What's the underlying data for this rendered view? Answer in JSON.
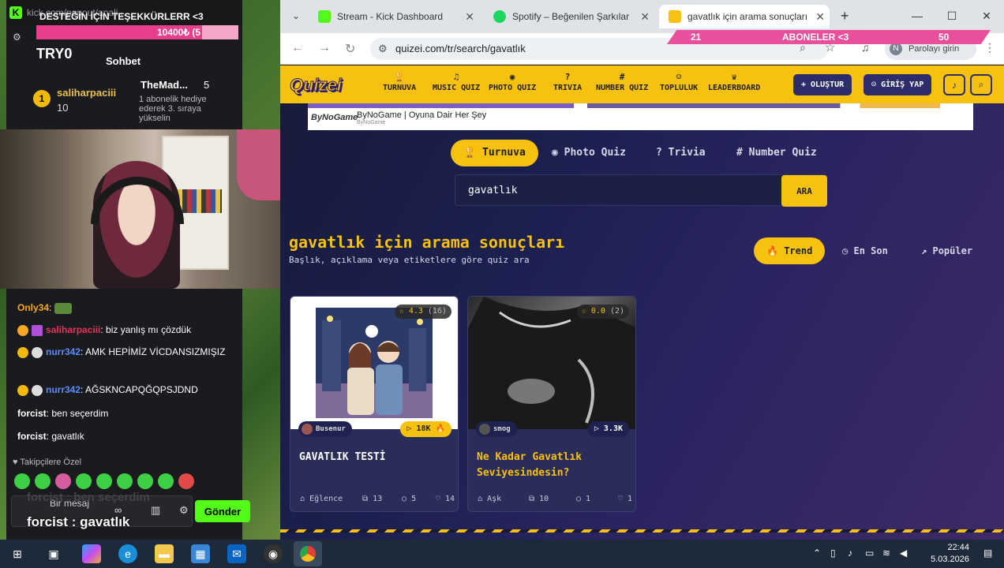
{
  "stream": {
    "url": "kick.com/popout/anali...",
    "goal_label": "10400₺ (5",
    "marquee": "DESTEĞİN İÇİN TEŞEKKÜRLERR <3",
    "streamer_tag": "TRY0",
    "chat_title": "Sohbet",
    "pinned": {
      "badge": "1",
      "user1": "saliharpaciii",
      "count1": "10",
      "user2": "TheMad...",
      "count2": "5",
      "gift_text": "1 abonelik hediye ederek 3. sıraya yükselin"
    },
    "messages": [
      {
        "user": "Only34",
        "text": "",
        "color": "#f5a623",
        "badge": ""
      },
      {
        "user": "saliharpaciii",
        "text": "biz yanlış mı çözdük",
        "color": "#e8345a",
        "badge": ""
      },
      {
        "user": "nurr342",
        "text": "AMK HEPİMİZ VİCDANSIZMIŞIZ",
        "color": "#5b8cff",
        "badge": "1"
      },
      {
        "user": "nurr342",
        "text": "AĞSKNCAPQĞQPSJDND",
        "color": "#5b8cff",
        "badge": "1"
      },
      {
        "user": "forcist",
        "text": "ben seçerdim",
        "color": "#ffffff",
        "badge": ""
      },
      {
        "user": "forcist",
        "text": "gavatlık",
        "color": "#ffffff",
        "badge": ""
      }
    ],
    "followers_only": "Takipçilere Özel",
    "input_placeholder": "Bir mesaj",
    "send_label": "Gönder",
    "overlay_user": "forcist",
    "overlay_text": "gavatlık",
    "ghost_text": "forcist : ben seçerdim"
  },
  "browser": {
    "tabs": [
      {
        "title": "Stream - Kick Dashboard",
        "color": "#53fc18"
      },
      {
        "title": "Spotify – Beğenilen Şarkılar",
        "color": "#1ed760"
      },
      {
        "title": "gavatlık için arama sonuçları - Q",
        "color": "#f7c10f"
      }
    ],
    "url": "quizei.com/tr/search/gavatlık",
    "password_label": "Parolayı girin",
    "password_initial": "N",
    "sub_overlay": {
      "left": "21",
      "label": "ABONELER <3",
      "right": "50"
    }
  },
  "site": {
    "logo": "Quizei",
    "nav": [
      {
        "icon": "🏆",
        "label": "TURNUVA"
      },
      {
        "icon": "♫",
        "label": "MUSIC QUIZ"
      },
      {
        "icon": "◉",
        "label": "PHOTO QUIZ"
      },
      {
        "icon": "?",
        "label": "TRIVIA"
      },
      {
        "icon": "#",
        "label": "NUMBER QUIZ"
      },
      {
        "icon": "☺",
        "label": "TOPLULUK"
      },
      {
        "icon": "♛",
        "label": "LEADERBOARD"
      }
    ],
    "create_label": "+ OLUŞTUR",
    "login_label": "GİRİŞ YAP",
    "ad": {
      "logo": "ByNoGame",
      "title": "ByNoGame | Oyuna Dair Her Şey",
      "sub": "ByNoGame"
    },
    "categories": [
      {
        "icon": "🏆",
        "label": "Turnuva"
      },
      {
        "icon": "◉",
        "label": "Photo Quiz"
      },
      {
        "icon": "?",
        "label": "Trivia"
      },
      {
        "icon": "#",
        "label": "Number Quiz"
      }
    ],
    "search_value": "gavatlık",
    "search_button": "ARA",
    "results_title": "gavatlık için arama sonuçları",
    "results_sub": "Başlık, açıklama veya etiketlere göre quiz ara",
    "sorts": [
      {
        "icon": "🔥",
        "label": "Trend"
      },
      {
        "icon": "◷",
        "label": "En Son"
      },
      {
        "icon": "↗",
        "label": "Popüler"
      }
    ],
    "cards": [
      {
        "rating": "4.3",
        "rating_count": "(16)",
        "author": "Busenur",
        "plays": "18K 🔥",
        "title": "GAVATLIK TESTİ",
        "category": "Eğlence",
        "questions": "13",
        "comments": "5",
        "likes": "14"
      },
      {
        "rating": "0.0",
        "rating_count": "(2)",
        "author": "smog",
        "plays": "3.3K",
        "title": "Ne Kadar Gavatlık Seviyesindesin?",
        "category": "Aşk",
        "questions": "10",
        "comments": "1",
        "likes": "1"
      }
    ]
  },
  "taskbar": {
    "time": "22:44",
    "date": "5.03.2026"
  }
}
